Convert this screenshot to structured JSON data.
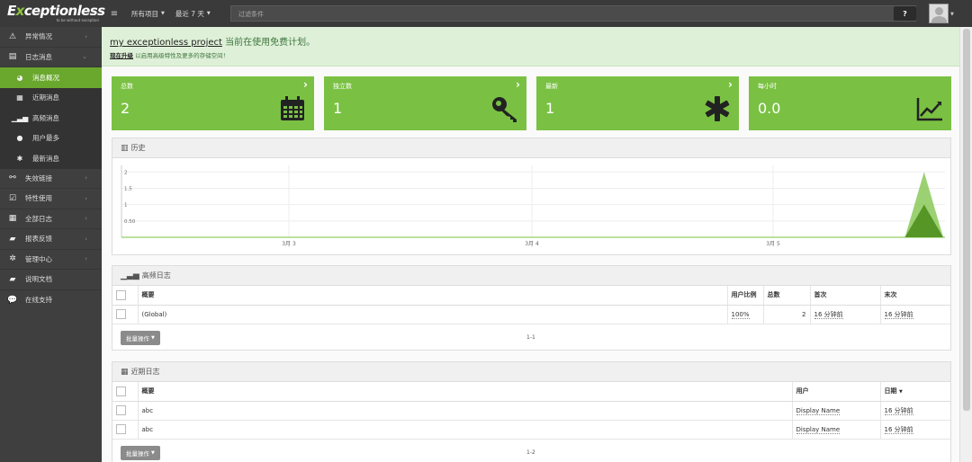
{
  "app": {
    "brand_prefix": "E",
    "brand_x": "x",
    "brand_suffix": "ceptionless",
    "tagline": "to be without exception"
  },
  "topbar": {
    "project_filter": "所有项目",
    "time_filter": "最近 7 天",
    "search_placeholder": "过滤条件",
    "help_label": "?"
  },
  "sidebar": {
    "items": [
      {
        "label": "异常情况",
        "icon": "warning-icon"
      },
      {
        "label": "日志消息",
        "icon": "document-icon",
        "expanded": true
      },
      {
        "label": "消息概况",
        "icon": "dashboard-icon",
        "active": true
      },
      {
        "label": "近期消息",
        "icon": "calendar-icon"
      },
      {
        "label": "高频消息",
        "icon": "signal-icon"
      },
      {
        "label": "用户最多",
        "icon": "users-icon"
      },
      {
        "label": "最新消息",
        "icon": "asterisk-icon"
      },
      {
        "label": "失效链接",
        "icon": "broken-link-icon"
      },
      {
        "label": "特性使用",
        "icon": "checkbox-icon"
      },
      {
        "label": "全部日志",
        "icon": "calendar-icon"
      },
      {
        "label": "报表反馈",
        "icon": "book-icon"
      },
      {
        "label": "管理中心",
        "icon": "gear-icon"
      },
      {
        "label": "说明文档",
        "icon": "book-icon"
      },
      {
        "label": "在线支持",
        "icon": "chat-icon"
      }
    ]
  },
  "notice": {
    "project_link": "my exceptionless project",
    "message": " 当前在使用免费计划。",
    "upgrade_link": "现在升级",
    "upgrade_text": " 以启用高级特性及更多的存储空间！"
  },
  "stats": [
    {
      "label": "总数",
      "value": "2",
      "icon": "calendar-icon"
    },
    {
      "label": "独立数",
      "value": "1",
      "icon": "key-icon"
    },
    {
      "label": "最新",
      "value": "1",
      "icon": "asterisk-icon"
    },
    {
      "label": "每小时",
      "value": "0.0",
      "icon": "line-chart-icon"
    }
  ],
  "history": {
    "title": "历史"
  },
  "chart_data": {
    "type": "area",
    "title": "历史",
    "x_ticks": [
      "3月 3",
      "3月 4",
      "3月 5"
    ],
    "y_ticks": [
      "0.50",
      "1",
      "1.5",
      "2"
    ],
    "ylim": [
      0,
      2.2
    ],
    "series": [
      {
        "values": [
          0,
          0,
          0,
          0,
          0,
          0,
          0,
          0,
          0,
          0,
          0,
          0,
          0,
          0,
          0,
          0,
          0,
          0,
          0,
          0,
          0,
          0,
          0,
          0,
          0,
          0,
          0,
          0,
          0,
          0,
          0,
          0,
          0,
          0,
          0,
          0,
          0,
          0,
          0,
          0,
          0,
          0,
          2,
          0
        ],
        "color": "#7ac143"
      },
      {
        "values": [
          0,
          0,
          0,
          0,
          0,
          0,
          0,
          0,
          0,
          0,
          0,
          0,
          0,
          0,
          0,
          0,
          0,
          0,
          0,
          0,
          0,
          0,
          0,
          0,
          0,
          0,
          0,
          0,
          0,
          0,
          0,
          0,
          0,
          0,
          0,
          0,
          0,
          0,
          0,
          0,
          0,
          0,
          1,
          0
        ],
        "color": "#4f8f1f"
      }
    ],
    "grid": true
  },
  "frequent": {
    "title": "高频日志",
    "columns": [
      "概要",
      "用户比例",
      "总数",
      "首次",
      "末次"
    ],
    "rows": [
      {
        "summary": "(Global)",
        "user_pct": "100%",
        "count": "2",
        "first": "16 分钟前",
        "last": "16 分钟前"
      }
    ],
    "bulk_label": "批量操作",
    "pager": "1-1"
  },
  "recent": {
    "title": "近期日志",
    "columns": [
      "概要",
      "用户",
      "日期"
    ],
    "rows": [
      {
        "summary": "abc",
        "user": "Display Name",
        "date": "16 分钟前"
      },
      {
        "summary": "abc",
        "user": "Display Name",
        "date": "16 分钟前"
      }
    ],
    "bulk_label": "批量操作",
    "pager": "1-2"
  },
  "colors": {
    "accent": "#7ac143",
    "active_nav": "#6aa82d",
    "topbar": "#3a3a3a",
    "sidebar": "#3f3f3f"
  }
}
